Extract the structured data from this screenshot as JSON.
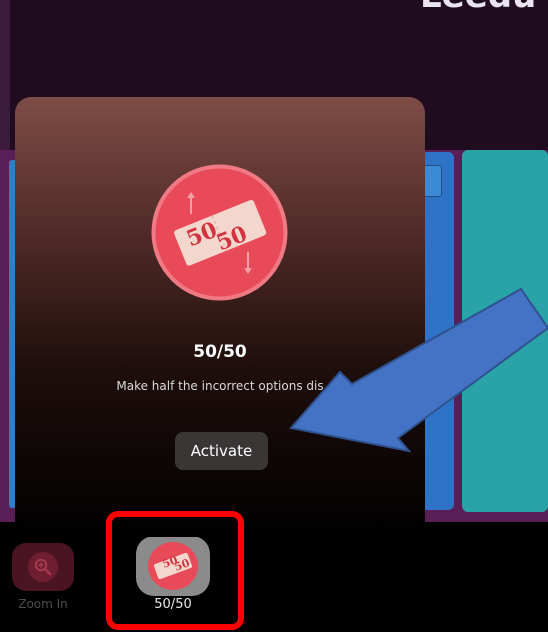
{
  "header": {
    "title_fragment": "Leedu"
  },
  "popup": {
    "title": "50/50",
    "description": "Make half the incorrect options dis",
    "activate_label": "Activate",
    "badge_text_left": "50",
    "badge_text_right": "50"
  },
  "powerups": {
    "zoom": {
      "label": "Zoom In",
      "icon": "zoom-in-icon"
    },
    "fifty": {
      "label": "50/50",
      "icon": "fifty-fifty-icon",
      "badge_text_left": "50",
      "badge_text_right": "50"
    }
  },
  "colors": {
    "background": "#000000",
    "badge_red": "#e84a59",
    "annotation_arrow": "#4472c4",
    "annotation_frame": "#ff0000"
  }
}
